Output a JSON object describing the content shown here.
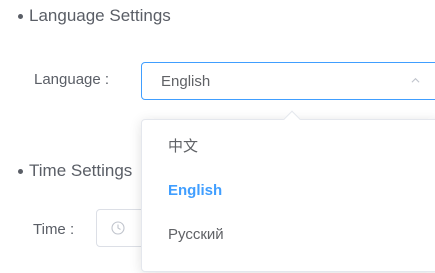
{
  "language_section": {
    "title": "Language Settings",
    "label": "Language :",
    "selected_value": "English",
    "options": [
      "中文",
      "English",
      "Русский"
    ]
  },
  "time_section": {
    "title": "Time Settings",
    "label": "Time :"
  },
  "colors": {
    "accent": "#409eff",
    "text": "#606266"
  },
  "icons": {
    "select_arrow": "chevron-up-icon",
    "time_icon": "clock-icon"
  }
}
